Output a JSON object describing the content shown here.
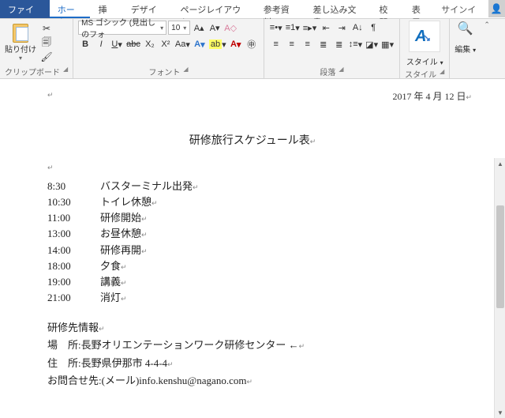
{
  "tabs": {
    "file": "ファイル",
    "home": "ホーム",
    "insert": "挿入",
    "design": "デザイン",
    "layout": "ページレイアウト",
    "references": "参考資料",
    "mailings": "差し込み文書",
    "review": "校閲",
    "view": "表示",
    "signin": "サインイン"
  },
  "ribbon": {
    "clipboard": {
      "paste": "貼り付け",
      "label": "クリップボード"
    },
    "font": {
      "family": "MS ゴシック (見出しのフォ",
      "size": "10",
      "label": "フォント",
      "bold": "B",
      "italic": "I",
      "underline": "U",
      "strike": "abc",
      "sub": "X₂",
      "sup": "X²",
      "case": "Aa",
      "clear": "A"
    },
    "paragraph": {
      "label": "段落"
    },
    "styles": {
      "label": "スタイル",
      "btn": "スタイル",
      "glyph": "A"
    },
    "editing": {
      "label": "編集",
      "btn": "編集"
    }
  },
  "document": {
    "date": "2017 年 4 月 12 日",
    "title": "研修旅行スケジュール表",
    "schedule": [
      {
        "time": "8:30",
        "text": "バスターミナル出発"
      },
      {
        "time": "10:30",
        "text": "トイレ休憩"
      },
      {
        "time": "11:00",
        "text": "研修開始"
      },
      {
        "time": "13:00",
        "text": "お昼休憩"
      },
      {
        "time": "14:00",
        "text": "研修再開"
      },
      {
        "time": "18:00",
        "text": "夕食"
      },
      {
        "time": "19:00",
        "text": "講義"
      },
      {
        "time": "21:00",
        "text": "消灯"
      }
    ],
    "info": {
      "heading": "研修先情報",
      "place_label": "場　所:",
      "place": "長野オリエンテーションワーク研修センター ←",
      "addr_label": "住　所:",
      "addr": "長野県伊那市 4-4-4",
      "contact_label": "お問合せ先:",
      "contact": "(メール)info.kenshu@nagano.com"
    }
  }
}
